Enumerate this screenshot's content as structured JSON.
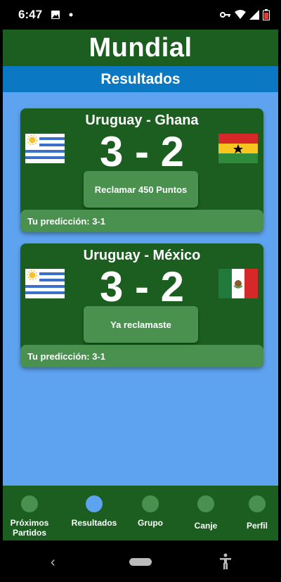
{
  "status_bar": {
    "time": "6:47",
    "icons": [
      "image-icon",
      "dot-icon",
      "vpn-key-icon",
      "wifi-icon",
      "signal-icon",
      "battery-icon"
    ]
  },
  "app": {
    "title": "Mundial",
    "section": "Resultados"
  },
  "matches": [
    {
      "title": "Uruguay - Ghana",
      "score": "3 - 2",
      "home_flag": "uruguay-flag-icon",
      "away_flag": "ghana-flag-icon",
      "button_label": "Reclamar 450 Puntos",
      "prediction": "Tu predicción: 3-1"
    },
    {
      "title": "Uruguay - México",
      "score": "3 - 2",
      "home_flag": "uruguay-flag-icon",
      "away_flag": "mexico-flag-icon",
      "button_label": "Ya reclamaste",
      "prediction": "Tu predicción: 3-1"
    }
  ],
  "bottom_nav": {
    "items": [
      {
        "label": "Próximos\nPartidos",
        "active": false
      },
      {
        "label": "Resultados",
        "active": true
      },
      {
        "label": "Grupo",
        "active": false
      },
      {
        "label": "Canje",
        "active": false
      },
      {
        "label": "Perfil",
        "active": false
      }
    ]
  },
  "colors": {
    "header_green": "#1b5e20",
    "button_green": "#4a9150",
    "section_blue": "#0a78c2",
    "background_blue": "#5ea3ef"
  }
}
